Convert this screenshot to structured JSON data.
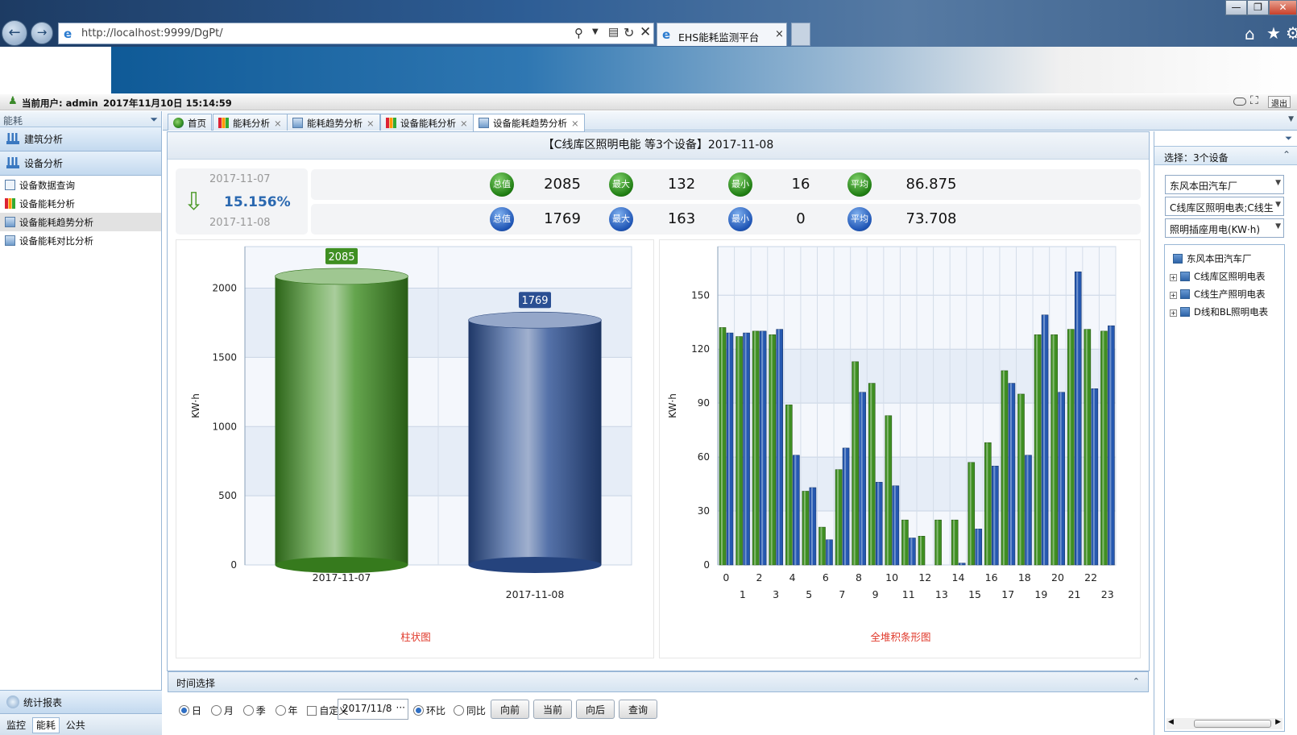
{
  "browser": {
    "url": "http://localhost:9999/DgPt/",
    "tab_title": "EHS能耗监测平台",
    "tab_close": "×"
  },
  "userbar": {
    "user_label": "当前用户: admin",
    "datetime": "2017年11月10日 15:14:59",
    "logout": "退出"
  },
  "left_panel": {
    "header": "能耗",
    "sections": [
      {
        "label": "建筑分析"
      },
      {
        "label": "设备分析"
      }
    ],
    "tree_items": [
      {
        "label": "设备数据查询"
      },
      {
        "label": "设备能耗分析"
      },
      {
        "label": "设备能耗趋势分析"
      },
      {
        "label": "设备能耗对比分析"
      }
    ],
    "footer_section": "统计报表",
    "footer_tabs": [
      "监控",
      "能耗",
      "公共"
    ]
  },
  "tabs": [
    {
      "label": "首页"
    },
    {
      "label": "能耗分析"
    },
    {
      "label": "能耗趋势分析"
    },
    {
      "label": "设备能耗分析"
    },
    {
      "label": "设备能耗趋势分析"
    }
  ],
  "main": {
    "title": "【C线库区照明电能 等3个设备】2017-11-08",
    "compare": {
      "date_prev": "2017-11-07",
      "percent": "15.156%",
      "date_curr": "2017-11-08"
    },
    "stats_rows": [
      {
        "total_label": "总值",
        "total": "2085",
        "max_label": "最大",
        "max": "132",
        "min_label": "最小",
        "min": "16",
        "avg_label": "平均",
        "avg": "86.875",
        "color": "#2e8b1e"
      },
      {
        "total_label": "总值",
        "total": "1769",
        "max_label": "最大",
        "max": "163",
        "min_label": "最小",
        "min": "0",
        "avg_label": "平均",
        "avg": "73.708",
        "color": "#2558b0"
      }
    ]
  },
  "chart_data": [
    {
      "type": "bar",
      "title": "柱状图",
      "ylabel": "KW·h",
      "categories": [
        "2017-11-07",
        "2017-11-08"
      ],
      "values": [
        2085,
        1769
      ],
      "data_labels": [
        "2085",
        "1769"
      ],
      "colors": [
        "#3f8f22",
        "#2b4f93"
      ],
      "ylim": [
        0,
        2300
      ],
      "yticks": [
        0,
        500,
        1000,
        1500,
        2000
      ],
      "grid": true
    },
    {
      "type": "bar",
      "title": "全堆积条形图",
      "ylabel": "KW·h",
      "categories": [
        "0",
        "1",
        "2",
        "3",
        "4",
        "5",
        "6",
        "7",
        "8",
        "9",
        "10",
        "11",
        "12",
        "13",
        "14",
        "15",
        "16",
        "17",
        "18",
        "19",
        "20",
        "21",
        "22",
        "23"
      ],
      "series": [
        {
          "values": [
            132,
            127,
            130,
            128,
            89,
            41,
            21,
            53,
            113,
            101,
            83,
            25,
            16,
            25,
            25,
            57,
            68,
            108,
            95,
            128,
            128,
            131,
            131,
            130
          ],
          "color": "#3f8f22"
        },
        {
          "values": [
            129,
            129,
            130,
            131,
            61,
            43,
            14,
            65,
            96,
            46,
            44,
            15,
            0,
            0,
            1,
            20,
            55,
            101,
            61,
            139,
            96,
            163,
            98,
            133
          ],
          "color": "#2558b0"
        }
      ],
      "ylim": [
        0,
        177
      ],
      "yticks": [
        0,
        30,
        60,
        90,
        120,
        150
      ],
      "grid": true
    }
  ],
  "time_section": {
    "header": "时间选择",
    "options": [
      "日",
      "月",
      "季",
      "年"
    ],
    "custom_label": "自定义",
    "date_value": "2017/11/8",
    "date_more": "···",
    "compare_options": [
      "环比",
      "同比"
    ],
    "buttons": {
      "prev": "向前",
      "current": "当前",
      "next": "向后",
      "query": "查询"
    }
  },
  "right_panel": {
    "selection_label": "选择：3个设备",
    "combo_factory": "东风本田汽车厂",
    "combo_meters": "C线库区照明电表;C线生",
    "combo_type": "照明插座用电(KW·h)",
    "tree": {
      "root": "东风本田汽车厂",
      "children": [
        "C线库区照明电表",
        "C线生产照明电表",
        "D线和BL照明电表"
      ]
    }
  }
}
